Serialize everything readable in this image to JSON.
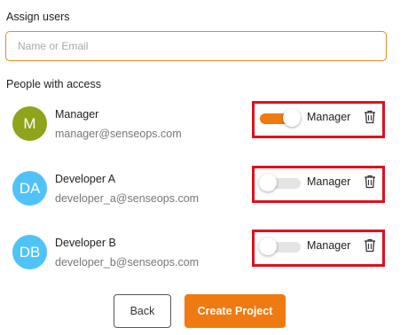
{
  "assign": {
    "label": "Assign users",
    "placeholder": "Name or Email",
    "value": ""
  },
  "people": {
    "label": "People with access",
    "list": [
      {
        "initials": "M",
        "name": "Manager",
        "email": "manager@senseops.com",
        "avatar_color": "#8fa31b",
        "role_label": "Manager",
        "is_manager": true
      },
      {
        "initials": "DA",
        "name": "Developer A",
        "email": "developer_a@senseops.com",
        "avatar_color": "#4fc3f7",
        "role_label": "Manager",
        "is_manager": false
      },
      {
        "initials": "DB",
        "name": "Developer B",
        "email": "developer_b@senseops.com",
        "avatar_color": "#4fc3f7",
        "role_label": "Manager",
        "is_manager": false
      }
    ]
  },
  "actions": {
    "back_label": "Back",
    "create_label": "Create Project"
  },
  "colors": {
    "accent": "#f07a12",
    "highlight": "#e0101e",
    "switch_off": "#e4e4e4"
  },
  "icons": {
    "delete": "trash-icon"
  }
}
